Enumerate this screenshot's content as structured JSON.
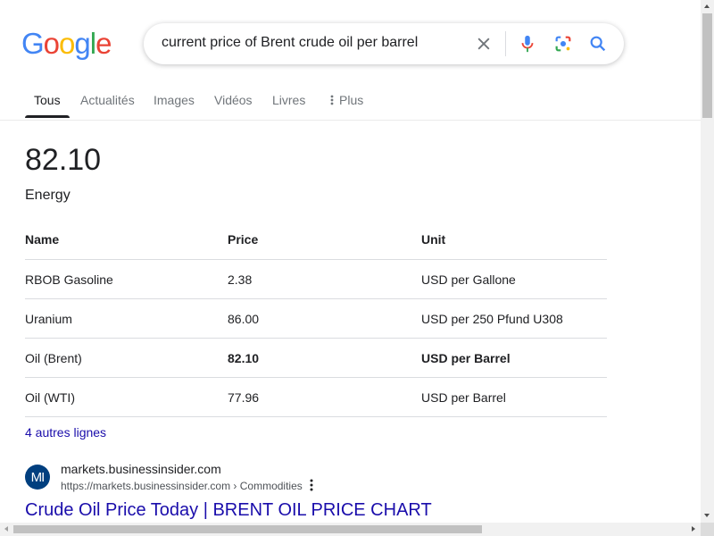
{
  "logo": {
    "letters": [
      "G",
      "o",
      "o",
      "g",
      "l",
      "e"
    ],
    "colors": [
      "#4285f4",
      "#ea4335",
      "#fbbc05",
      "#4285f4",
      "#34a853",
      "#ea4335"
    ]
  },
  "search": {
    "query": "current price of Brent crude oil per barrel"
  },
  "icons": {
    "clear": "close-icon",
    "voice": "microphone-icon",
    "lens": "lens-icon",
    "search": "search-icon"
  },
  "tabs": [
    {
      "label": "Tous",
      "active": true
    },
    {
      "label": "Actualités"
    },
    {
      "label": "Images"
    },
    {
      "label": "Vidéos"
    },
    {
      "label": "Livres"
    },
    {
      "label": "Plus"
    }
  ],
  "answer": {
    "value": "82.10",
    "category": "Energy",
    "headers": [
      "Name",
      "Price",
      "Unit"
    ],
    "rows": [
      [
        "RBOB Gasoline",
        "2.38",
        "USD per Gallone"
      ],
      [
        "Uranium",
        "86.00",
        "USD per 250 Pfund U308"
      ],
      [
        "Oil (Brent)",
        "82.10",
        "USD per Barrel"
      ],
      [
        "Oil (WTI)",
        "77.96",
        "USD per Barrel"
      ]
    ],
    "highlighted_row": 2,
    "more_rows_label": "4 autres lignes"
  },
  "result": {
    "favicon_text": "MI",
    "site_name": "markets.businessinsider.com",
    "url": "https://markets.businessinsider.com › Commodities",
    "title": "Crude Oil Price Today | BRENT OIL PRICE CHART"
  },
  "colors": {
    "link": "#1a0dab",
    "accent": "#4285f4"
  }
}
